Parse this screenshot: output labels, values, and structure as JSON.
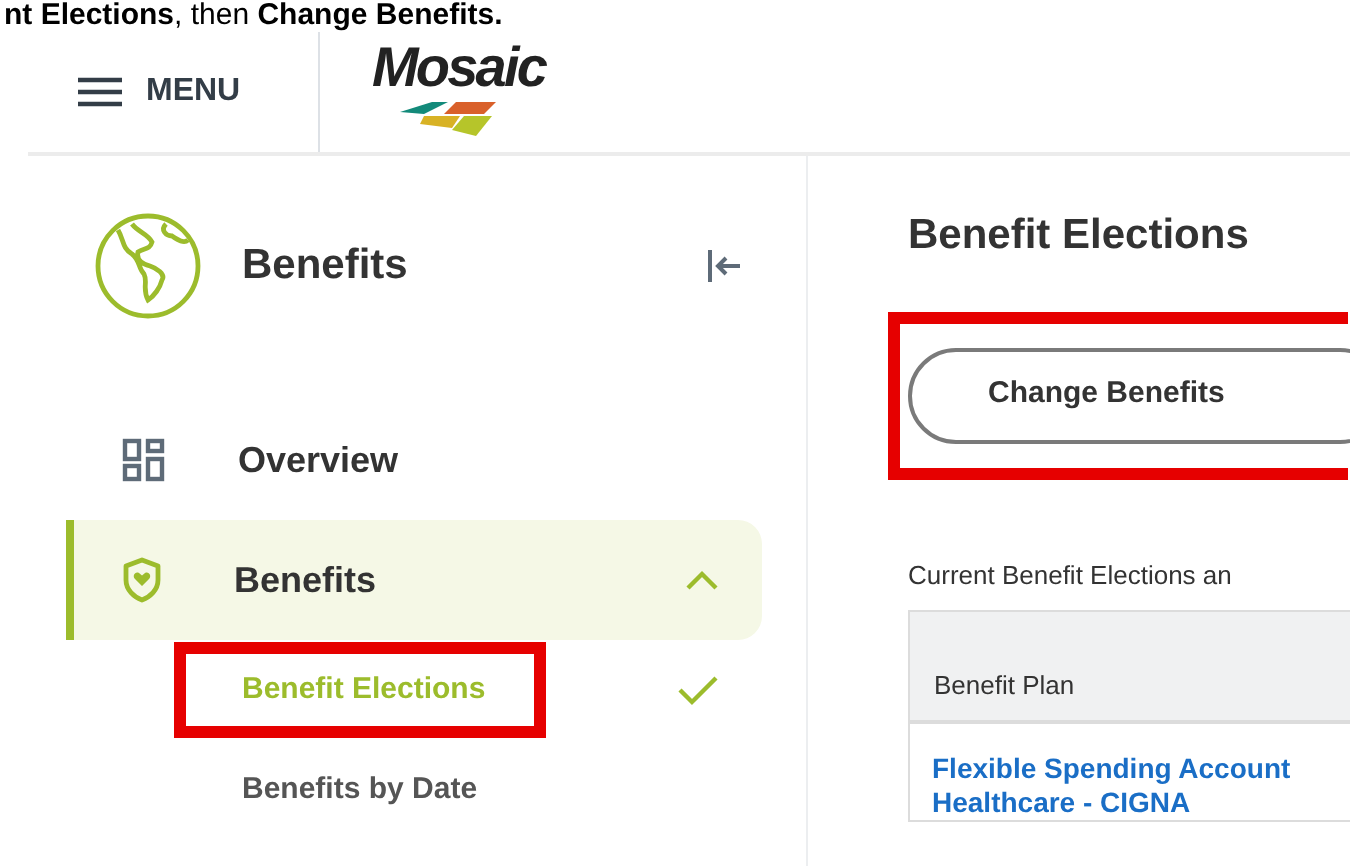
{
  "instruction": "**nt Elections**, then **Change Benefits.**",
  "header": {
    "menu_label": "MENU",
    "logo_text": "Mosaic"
  },
  "sidebar": {
    "title": "Benefits",
    "items": [
      {
        "label": "Overview",
        "kind": "grid",
        "selected": false,
        "expanded": false
      },
      {
        "label": "Benefits",
        "kind": "shield",
        "selected": true,
        "expanded": true,
        "children": [
          {
            "label": "Benefit Elections",
            "selected": true,
            "highlighted": true
          },
          {
            "label": "Benefits by Date",
            "selected": false,
            "highlighted": false
          }
        ]
      }
    ]
  },
  "main": {
    "title": "Benefit Elections",
    "action": {
      "label": "Change Benefits",
      "highlighted": true
    },
    "table_caption": "Current Benefit Elections an",
    "table": {
      "columns": [
        "Benefit Plan"
      ],
      "rows": [
        {
          "plan_lines": [
            "Flexible Spending Account",
            "Healthcare - CIGNA"
          ]
        }
      ]
    }
  }
}
